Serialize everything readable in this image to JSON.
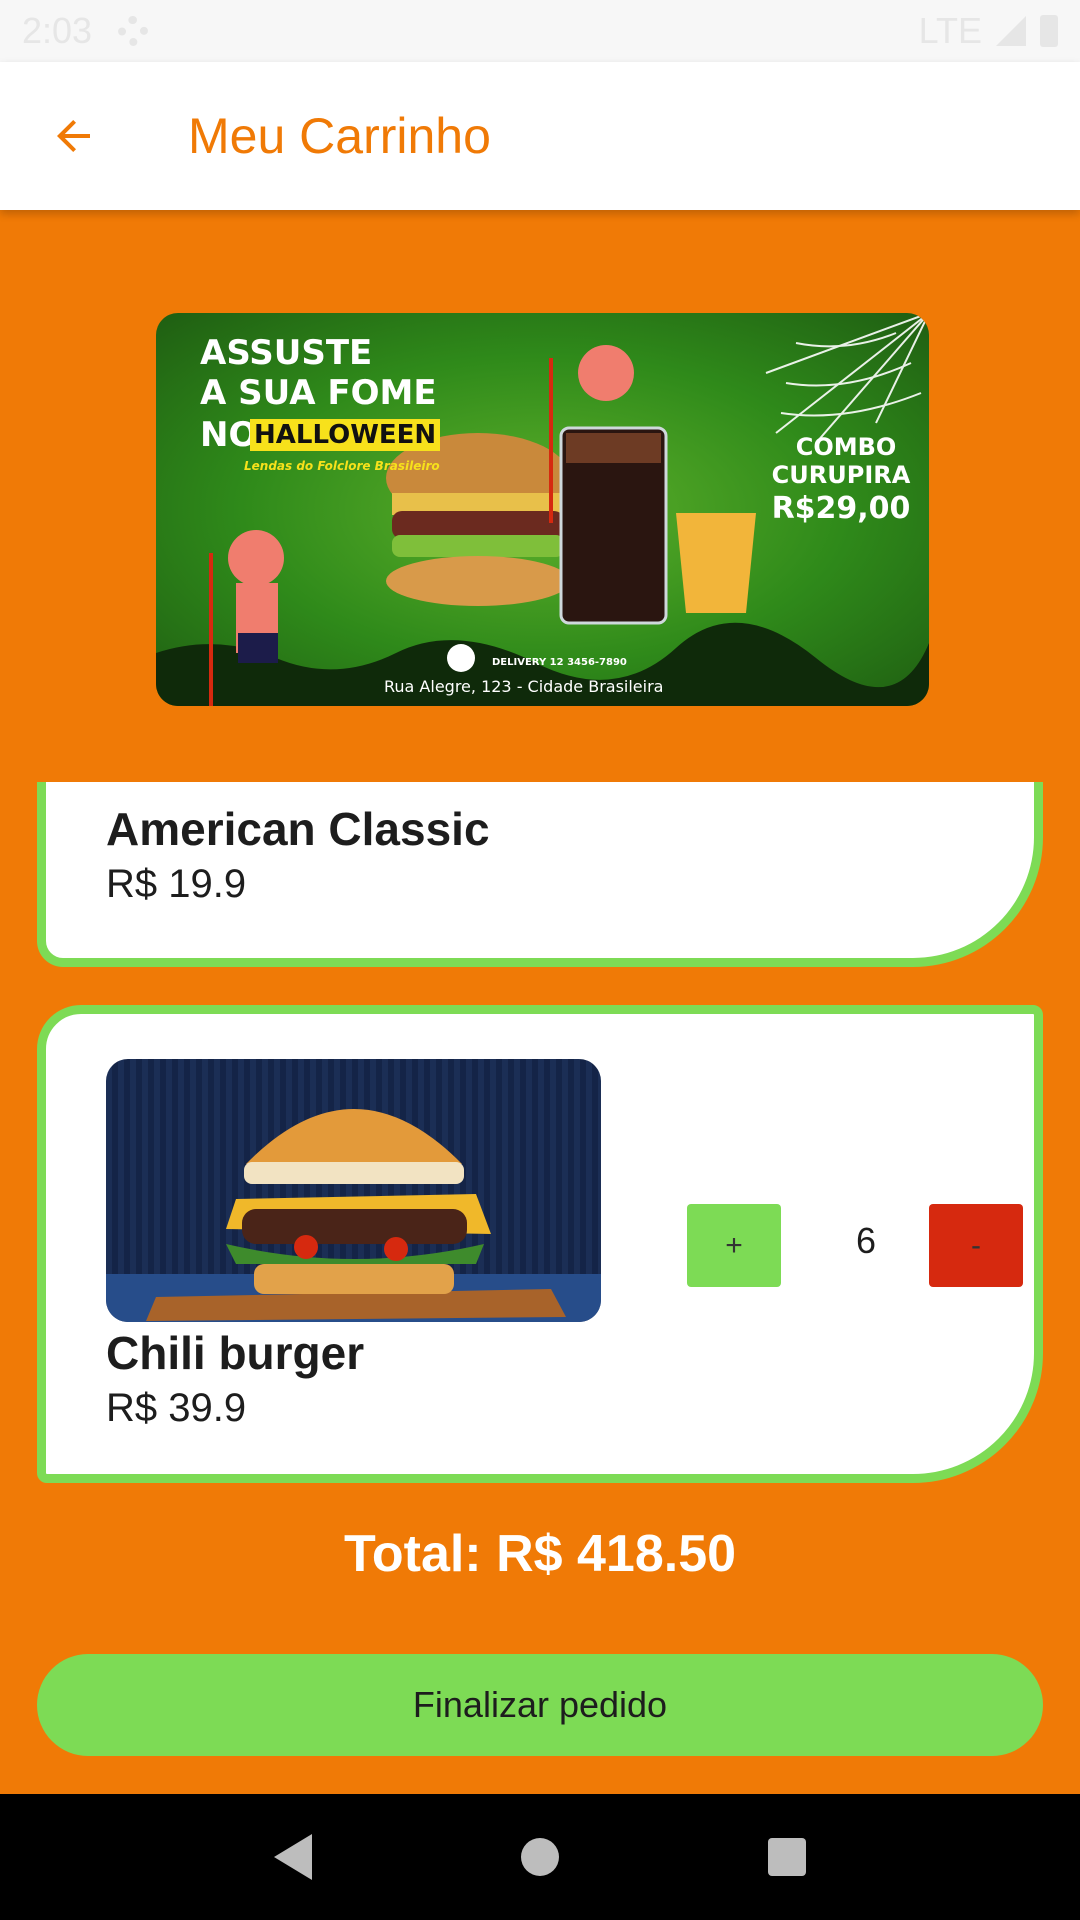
{
  "status_bar": {
    "time": "2:03",
    "network": "LTE"
  },
  "app_bar": {
    "title": "Meu Carrinho",
    "back_icon": "arrow-left-icon"
  },
  "banner": {
    "headline_1": "ASSUSTE",
    "headline_2": "A SUA FOME",
    "headline_3": "NO",
    "headline_highlight": "HALLOWEEN",
    "subtitle": "Lendas do Folclore Brasileiro",
    "combo_1": "COMBO",
    "combo_2": "CURUPIRA",
    "combo_price": "R$29,00",
    "delivery": "DELIVERY 12 3456-7890",
    "address": "Rua Alegre, 123 - Cidade Brasileira"
  },
  "cart": {
    "items": [
      {
        "name": "American Classic",
        "price": "R$ 19.9"
      },
      {
        "name": "Chili burger",
        "price": "R$ 39.9",
        "quantity": "6",
        "plus_label": "+",
        "minus_label": "-"
      }
    ]
  },
  "total": "Total: R$ 418.50",
  "finish_button": "Finalizar pedido",
  "colors": {
    "primary": "#f07a06",
    "accent_green": "#7ddb55",
    "danger_red": "#d6290f"
  }
}
